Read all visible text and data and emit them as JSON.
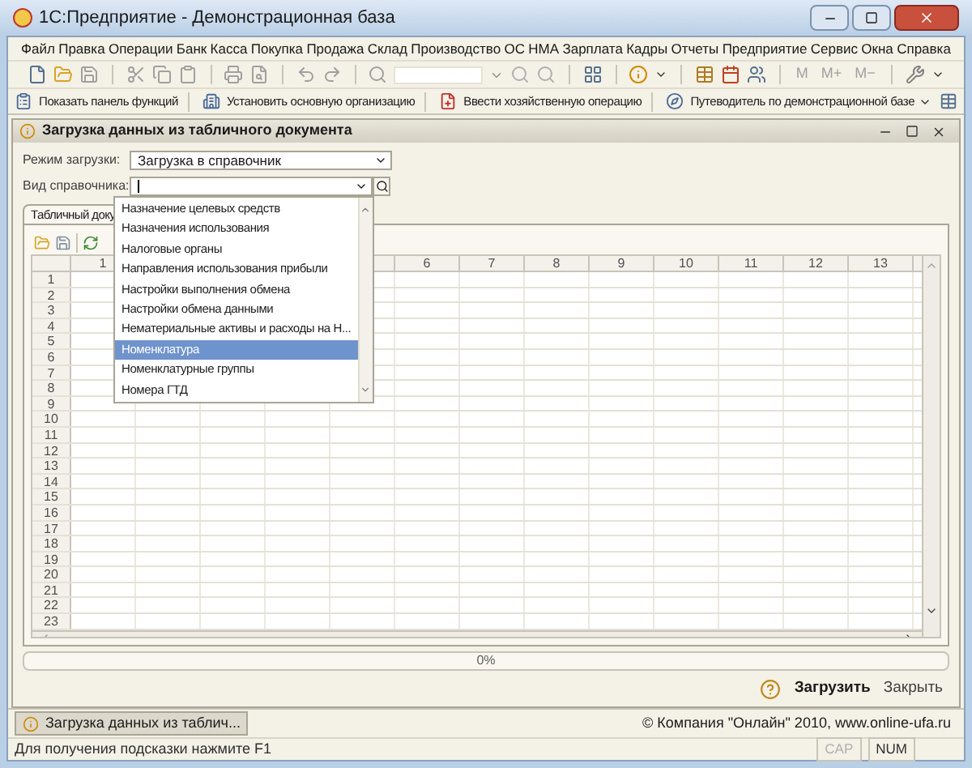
{
  "window": {
    "title": "1С:Предприятие - Демонстрационная база"
  },
  "menu": [
    "Файл",
    "Правка",
    "Операции",
    "Банк",
    "Касса",
    "Покупка",
    "Продажа",
    "Склад",
    "Производство",
    "ОС",
    "НМА",
    "Зарплата",
    "Кадры",
    "Отчеты",
    "Предприятие",
    "Сервис",
    "Окна",
    "Справка"
  ],
  "toolbar": {
    "memory_buttons": [
      "M",
      "M+",
      "M−"
    ]
  },
  "function_bar": [
    "Показать панель функций",
    "Установить основную организацию",
    "Ввести хозяйственную операцию",
    "Путеводитель по демонстрационной базе"
  ],
  "form": {
    "title": "Загрузка данных из табличного документа",
    "load_mode": {
      "label": "Режим загрузки:",
      "value": "Загрузка в справочник"
    },
    "catalog_type": {
      "label": "Вид справочника:"
    },
    "tabs": [
      {
        "label": "Табличный доку",
        "selected": true
      }
    ],
    "dropdown": [
      {
        "label": "Назначение целевых средств",
        "selected": false
      },
      {
        "label": "Назначения использования",
        "selected": false
      },
      {
        "label": "Налоговые органы",
        "selected": false
      },
      {
        "label": "Направления использования прибыли",
        "selected": false
      },
      {
        "label": "Настройки выполнения обмена",
        "selected": false
      },
      {
        "label": "Настройки обмена данными",
        "selected": false
      },
      {
        "label": "Нематериальные активы и расходы на Н...",
        "selected": false
      },
      {
        "label": "Номенклатура",
        "selected": true
      },
      {
        "label": "Номенклатурные группы",
        "selected": false
      },
      {
        "label": "Номера ГТД",
        "selected": false
      }
    ],
    "grid": {
      "columns": [
        "1",
        "6",
        "7",
        "8",
        "9",
        "10",
        "11",
        "12",
        "13"
      ],
      "rows": [
        "1",
        "2",
        "3",
        "4",
        "5",
        "6",
        "7",
        "8",
        "9",
        "10",
        "11",
        "12",
        "13",
        "14",
        "15",
        "16",
        "17",
        "18",
        "19",
        "20",
        "21",
        "22",
        "23"
      ]
    },
    "progress": {
      "level": 0,
      "reading": "0%"
    },
    "buttons": [
      {
        "label": "Загрузить",
        "kind": "primary"
      },
      {
        "label": "Закрыть",
        "kind": "plain"
      }
    ]
  },
  "taskbar": [
    {
      "label": "Загрузка данных из таблич...",
      "selected": true
    }
  ],
  "copyright": "© Компания \"Онлайн\" 2010, www.online-ufa.ru",
  "status_bar": {
    "hint": "Для получения подсказки нажмите F1",
    "indicators": [
      {
        "label": "CAP",
        "on": false
      },
      {
        "label": "NUM",
        "on": true
      }
    ]
  }
}
